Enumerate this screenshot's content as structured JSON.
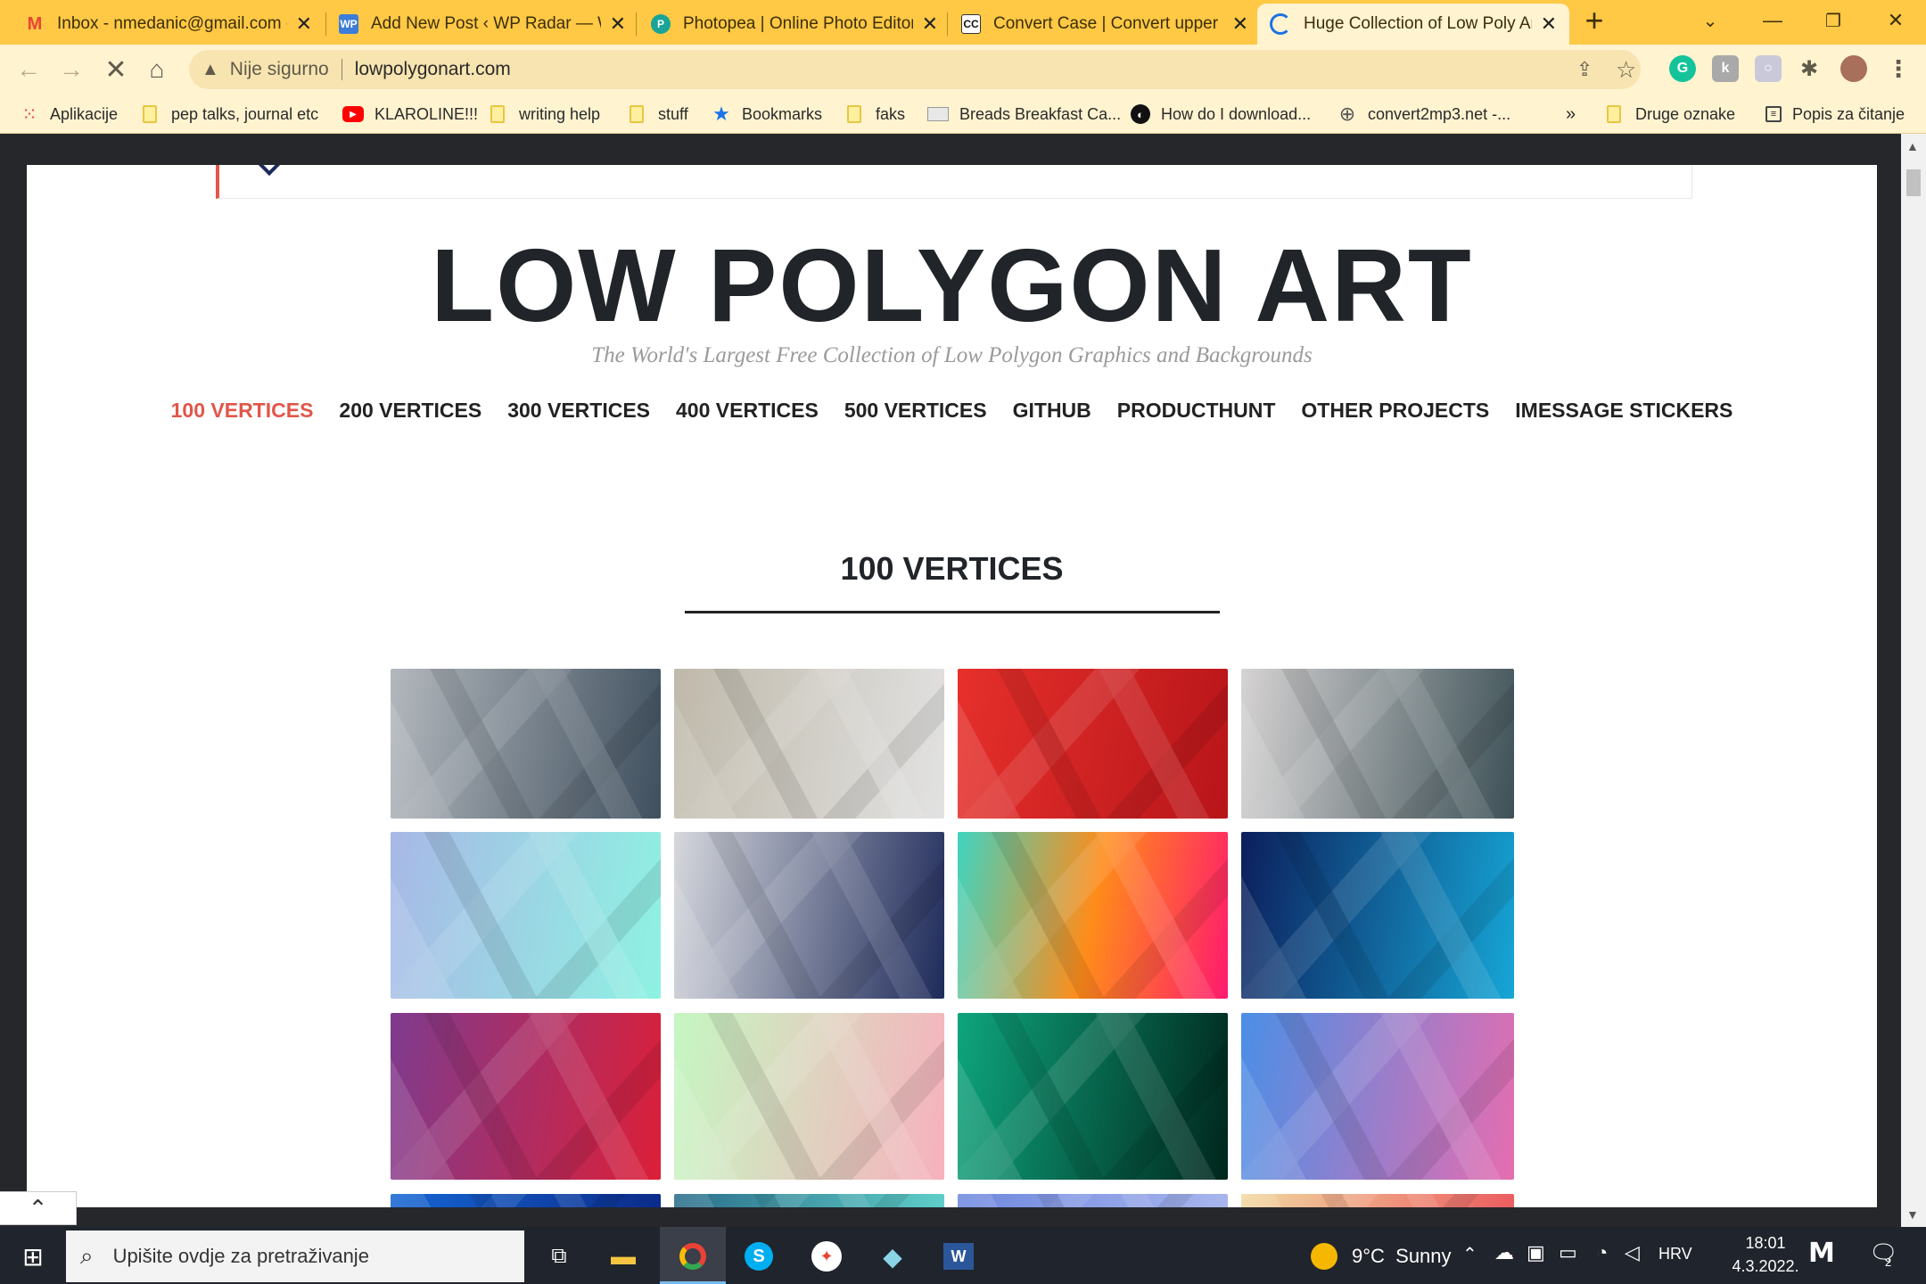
{
  "tabs": [
    {
      "title": "Inbox - nmedanic@gmail.com -",
      "icon": "gmail-icon",
      "favicon": "M",
      "color": "#ea4335"
    },
    {
      "title": "Add New Post ‹ WP Radar — W",
      "icon": "wp-icon",
      "favicon": "WP",
      "color": "#3b7dd8"
    },
    {
      "title": "Photopea | Online Photo Editor",
      "icon": "photopea-icon",
      "favicon": "P",
      "color": "#18a497"
    },
    {
      "title": "Convert Case | Convert upper c",
      "icon": "convertcase-icon",
      "favicon": "CC",
      "color": "#111"
    },
    {
      "title": "Huge Collection of Low Poly Art",
      "icon": "loading-spinner-icon",
      "favicon": "C",
      "color": "#1a73e8",
      "active": true
    }
  ],
  "toolbar": {
    "security_label": "Nije sigurno",
    "url": "lowpolygonart.com"
  },
  "bookmarks": [
    {
      "label": "Aplikacije",
      "icon": "apps-grid-icon"
    },
    {
      "label": "pep talks, journal etc",
      "icon": "folder-icon"
    },
    {
      "label": "KLAROLINE!!!",
      "icon": "youtube-icon"
    },
    {
      "label": "writing help",
      "icon": "folder-icon"
    },
    {
      "label": "stuff",
      "icon": "folder-icon"
    },
    {
      "label": "Bookmarks",
      "icon": "star-icon"
    },
    {
      "label": "faks",
      "icon": "folder-icon"
    },
    {
      "label": "Breads Breakfast Ca...",
      "icon": "page-icon"
    },
    {
      "label": "How do I download...",
      "icon": "site-icon"
    },
    {
      "label": "convert2mp3.net -...",
      "icon": "globe-icon"
    },
    {
      "label": "»",
      "icon": "overflow-icon"
    },
    {
      "label": "Druge oznake",
      "icon": "folder-icon"
    },
    {
      "label": "Popis za čitanje",
      "icon": "reading-list-icon"
    }
  ],
  "site": {
    "title": "LOW POLYGON ART",
    "tagline": "The World's Largest Free Collection of Low Polygon Graphics and Backgrounds",
    "nav": [
      {
        "label": "100 VERTICES",
        "active": true
      },
      {
        "label": "200 VERTICES"
      },
      {
        "label": "300 VERTICES"
      },
      {
        "label": "400 VERTICES"
      },
      {
        "label": "500 VERTICES"
      },
      {
        "label": "GITHUB"
      },
      {
        "label": "PRODUCTHUNT"
      },
      {
        "label": "OTHER PROJECTS"
      },
      {
        "label": "IMESSAGE STICKERS"
      }
    ],
    "section_title": "100 VERTICES",
    "accent_color": "#e0574b",
    "thumbnails": [
      {
        "name": "gray-slate",
        "from": "#b3b8bd",
        "to": "#3f4f5e"
      },
      {
        "name": "silver-white",
        "from": "#bfb9aa",
        "to": "#e2e2e2"
      },
      {
        "name": "red",
        "from": "#e6302b",
        "to": "#b8151a"
      },
      {
        "name": "silver-teal",
        "from": "#d6d3d3",
        "to": "#3d5157"
      },
      {
        "name": "lavender-mint",
        "from": "#a8b8e6",
        "to": "#8ef2e2"
      },
      {
        "name": "gray-navy",
        "from": "#d6d8dd",
        "to": "#1e2a5a"
      },
      {
        "name": "teal-orange-pink",
        "from": "#3fd4c0",
        "to": "#ff1a6e",
        "mid": "#ff8c1a"
      },
      {
        "name": "navy-cyan",
        "from": "#0c1f5c",
        "to": "#16a6d6"
      },
      {
        "name": "purple-red",
        "from": "#7e3b8e",
        "to": "#dc1f38"
      },
      {
        "name": "mint-pink",
        "from": "#c5f7c2",
        "to": "#f7b1bd"
      },
      {
        "name": "green-black",
        "from": "#0ea57d",
        "to": "#00261c"
      },
      {
        "name": "blue-pink",
        "from": "#4a8fe6",
        "to": "#e66db0"
      },
      {
        "name": "blue",
        "from": "#1566d4",
        "to": "#0b2a88"
      },
      {
        "name": "teal",
        "from": "#2a6d8a",
        "to": "#5fd0c9"
      },
      {
        "name": "periwinkle",
        "from": "#6f88de",
        "to": "#a9b6ee"
      },
      {
        "name": "peach",
        "from": "#f1d9a0",
        "to": "#ec5b5f"
      }
    ]
  },
  "taskbar": {
    "search_placeholder": "Upišite ovdje za pretraživanje",
    "weather": "9°C  Sunny",
    "language": "HRV",
    "time": "18:01",
    "date": "4.3.2022.",
    "notification_count": "2"
  }
}
